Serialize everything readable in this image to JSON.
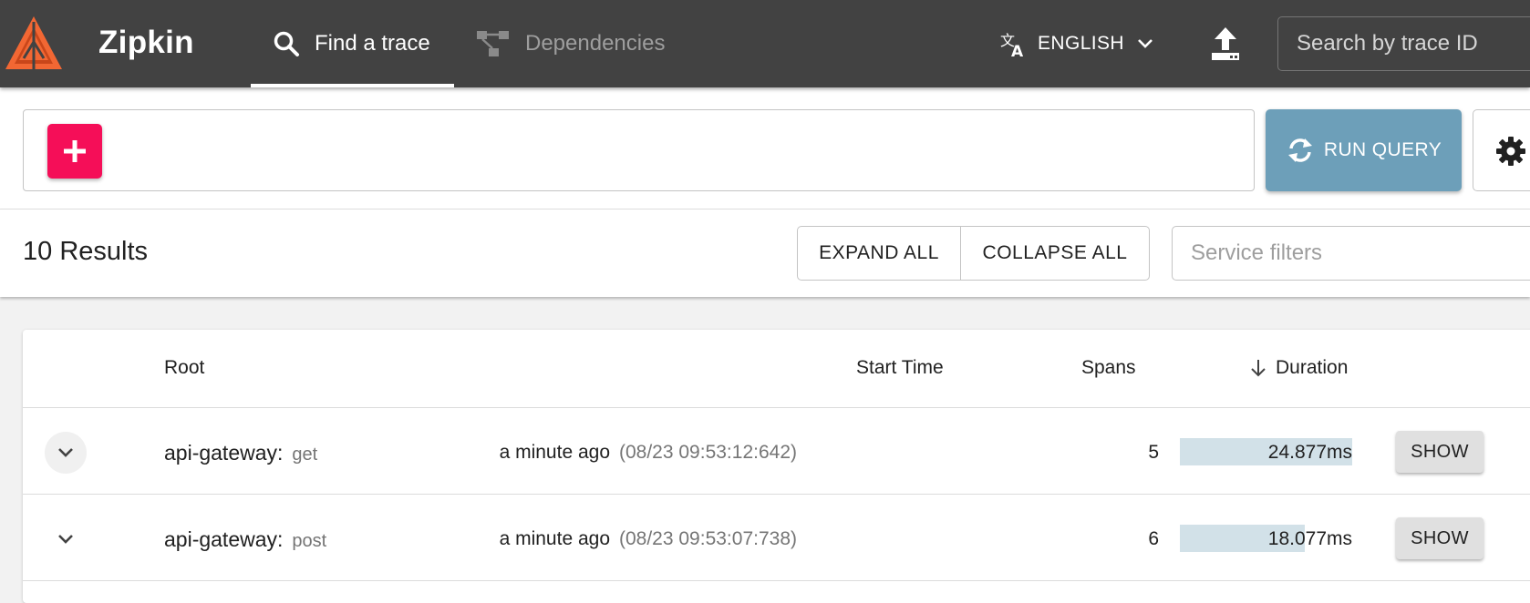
{
  "header": {
    "app_name": "Zipkin",
    "tabs": [
      {
        "label": "Find a trace",
        "icon": "search-icon",
        "active": true
      },
      {
        "label": "Dependencies",
        "icon": "dependencies-icon",
        "active": false
      }
    ],
    "language": {
      "label": "ENGLISH",
      "icon": "translate-icon"
    },
    "upload_icon": "upload-icon",
    "trace_search": {
      "placeholder": "Search by trace ID"
    }
  },
  "query": {
    "add_icon": "plus-icon",
    "run_label": "RUN QUERY",
    "run_icon": "sync-icon",
    "settings_icon": "gear-icon"
  },
  "results": {
    "count_label": "10 Results",
    "expand_all": "EXPAND ALL",
    "collapse_all": "COLLAPSE ALL",
    "service_filter_placeholder": "Service filters"
  },
  "table": {
    "headers": {
      "root": "Root",
      "start": "Start Time",
      "spans": "Spans",
      "duration": "Duration"
    },
    "rows": [
      {
        "service": "api-gateway:",
        "method": "get",
        "relative": "a minute ago",
        "absolute": "(08/23 09:53:12:642)",
        "spans": "5",
        "duration": "24.877ms",
        "duration_fraction": 1.0,
        "show": "SHOW"
      },
      {
        "service": "api-gateway:",
        "method": "post",
        "relative": "a minute ago",
        "absolute": "(08/23 09:53:07:738)",
        "spans": "6",
        "duration": "18.077ms",
        "duration_fraction": 0.727,
        "show": "SHOW"
      }
    ]
  },
  "colors": {
    "header_bg": "#424242",
    "logo_orange": "#f26733",
    "add_button": "#f50e58",
    "run_button": "#6d9fb9",
    "duration_bar": "#d2e1e8"
  }
}
